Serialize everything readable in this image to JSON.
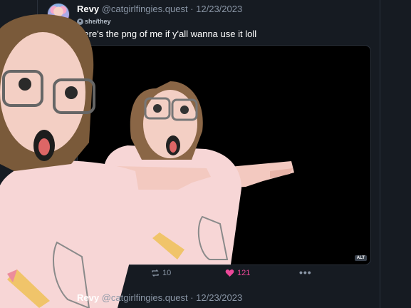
{
  "post": {
    "display_name": "Revy",
    "handle": "@catgirlfingies.quest",
    "date": "12/23/2023",
    "separator": " · ",
    "pronouns": "she/they",
    "text": "Here's the png of me if y'all wanna use it loll",
    "media_alt_badge": "ALT",
    "repost_count": "10",
    "like_count": "121"
  },
  "next_post": {
    "display_name": "Revy",
    "handle": "@catgirlfingies.quest",
    "separator": " · ",
    "date": "12/23/2023"
  },
  "icons": {
    "pronoun": "globe-icon",
    "repost": "repost-icon",
    "like": "heart-icon",
    "more": "more-icon"
  },
  "colors": {
    "background": "#161b22",
    "like_accent": "#ec4899",
    "muted_text": "#8a96a6"
  }
}
